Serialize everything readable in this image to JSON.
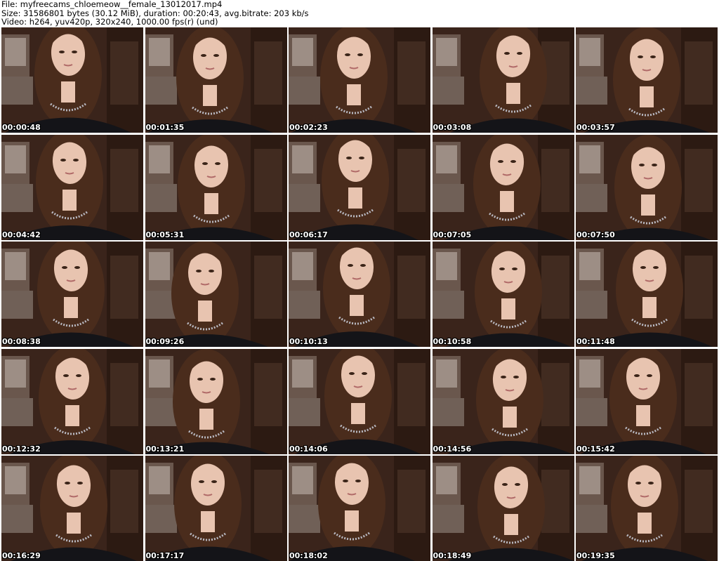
{
  "header": {
    "file_line": "File: myfreecams_chloemeow__female_13012017.mp4",
    "size_line": "Size: 31586801 bytes (30.12 MiB), duration: 00:20:43, avg.bitrate: 203 kb/s",
    "video_line": "Video: h264, yuv420p, 320x240, 1000.00 fps(r) (und)"
  },
  "thumbnails": [
    {
      "timestamp": "00:00:48"
    },
    {
      "timestamp": "00:01:35"
    },
    {
      "timestamp": "00:02:23"
    },
    {
      "timestamp": "00:03:08"
    },
    {
      "timestamp": "00:03:57"
    },
    {
      "timestamp": "00:04:42"
    },
    {
      "timestamp": "00:05:31"
    },
    {
      "timestamp": "00:06:17"
    },
    {
      "timestamp": "00:07:05"
    },
    {
      "timestamp": "00:07:50"
    },
    {
      "timestamp": "00:08:38"
    },
    {
      "timestamp": "00:09:26"
    },
    {
      "timestamp": "00:10:13"
    },
    {
      "timestamp": "00:10:58"
    },
    {
      "timestamp": "00:11:48"
    },
    {
      "timestamp": "00:12:32"
    },
    {
      "timestamp": "00:13:21"
    },
    {
      "timestamp": "00:14:06"
    },
    {
      "timestamp": "00:14:56"
    },
    {
      "timestamp": "00:15:42"
    },
    {
      "timestamp": "00:16:29"
    },
    {
      "timestamp": "00:17:17"
    },
    {
      "timestamp": "00:18:02"
    },
    {
      "timestamp": "00:18:49"
    },
    {
      "timestamp": "00:19:35"
    }
  ],
  "colors": {
    "background": "#ffffff",
    "room": "#3a241b",
    "hair": "#4a2c1c",
    "skin": "#e8c4b0",
    "shirt": "#141418"
  }
}
